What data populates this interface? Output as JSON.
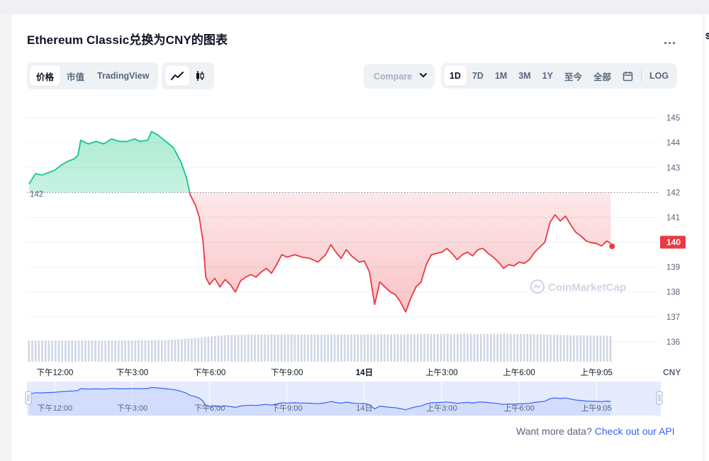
{
  "header": {
    "title": "Ethereum Classic兑换为CNY的图表",
    "more_label": "..."
  },
  "toolbar": {
    "metric_tabs": [
      {
        "label": "价格",
        "active": true
      },
      {
        "label": "市值",
        "active": false
      },
      {
        "label": "TradingView",
        "active": false
      }
    ],
    "chart_type": [
      "line-chart-icon",
      "candlestick-icon"
    ],
    "compare_label": "Compare",
    "ranges": [
      {
        "label": "1D",
        "active": true
      },
      {
        "label": "7D",
        "active": false
      },
      {
        "label": "1M",
        "active": false
      },
      {
        "label": "3M",
        "active": false
      },
      {
        "label": "1Y",
        "active": false
      },
      {
        "label": "至今",
        "active": false
      },
      {
        "label": "全部",
        "active": false
      }
    ],
    "calendar_icon": "calendar-icon",
    "log_label": "LOG"
  },
  "chart_data": {
    "type": "area",
    "currency_label": "CNY",
    "reference_label": "142",
    "reference_value": 142,
    "current_price_label": "140",
    "ylim": [
      135.2,
      145.6
    ],
    "yticks": [
      136,
      137,
      138,
      139,
      140,
      141,
      142,
      143,
      144,
      145
    ],
    "xlim": [
      0,
      24
    ],
    "xticks": [
      {
        "t": 1.0,
        "label": "下午12:00"
      },
      {
        "t": 4.0,
        "label": "下午3:00"
      },
      {
        "t": 7.0,
        "label": "下午6:00"
      },
      {
        "t": 10.0,
        "label": "下午9:00"
      },
      {
        "t": 13.0,
        "label": "14日"
      },
      {
        "t": 16.0,
        "label": "上午3:00"
      },
      {
        "t": 19.0,
        "label": "上午6:00"
      },
      {
        "t": 22.0,
        "label": "上午9:05"
      }
    ],
    "colors": {
      "up": "#16c784",
      "down": "#ea3943",
      "volume": "#cfd6e4",
      "navigator": "#3861fb",
      "navigator_fill": "#e5ebfd"
    },
    "price_series": [
      [
        0.0,
        142.35
      ],
      [
        0.25,
        142.75
      ],
      [
        0.5,
        142.7
      ],
      [
        0.75,
        142.8
      ],
      [
        1.0,
        142.9
      ],
      [
        1.25,
        143.1
      ],
      [
        1.5,
        143.25
      ],
      [
        1.75,
        143.35
      ],
      [
        1.9,
        143.5
      ],
      [
        2.0,
        144.1
      ],
      [
        2.3,
        143.95
      ],
      [
        2.6,
        144.05
      ],
      [
        2.9,
        143.95
      ],
      [
        3.2,
        144.15
      ],
      [
        3.5,
        144.05
      ],
      [
        3.8,
        144.05
      ],
      [
        4.1,
        144.15
      ],
      [
        4.3,
        144.05
      ],
      [
        4.6,
        144.1
      ],
      [
        4.75,
        144.45
      ],
      [
        5.0,
        144.3
      ],
      [
        5.3,
        144.05
      ],
      [
        5.6,
        143.8
      ],
      [
        5.9,
        143.2
      ],
      [
        6.1,
        142.6
      ],
      [
        6.25,
        141.9
      ],
      [
        6.45,
        141.5
      ],
      [
        6.6,
        141.0
      ],
      [
        6.75,
        140.0
      ],
      [
        6.85,
        138.6
      ],
      [
        7.0,
        138.3
      ],
      [
        7.2,
        138.55
      ],
      [
        7.4,
        138.2
      ],
      [
        7.6,
        138.5
      ],
      [
        7.8,
        138.3
      ],
      [
        8.0,
        138.0
      ],
      [
        8.2,
        138.45
      ],
      [
        8.4,
        138.6
      ],
      [
        8.6,
        138.7
      ],
      [
        8.8,
        138.6
      ],
      [
        9.0,
        138.8
      ],
      [
        9.2,
        138.95
      ],
      [
        9.4,
        138.75
      ],
      [
        9.6,
        139.1
      ],
      [
        9.8,
        139.5
      ],
      [
        10.0,
        139.4
      ],
      [
        10.3,
        139.5
      ],
      [
        10.6,
        139.4
      ],
      [
        10.9,
        139.35
      ],
      [
        11.2,
        139.2
      ],
      [
        11.5,
        139.5
      ],
      [
        11.7,
        139.9
      ],
      [
        11.9,
        139.6
      ],
      [
        12.1,
        139.35
      ],
      [
        12.3,
        139.7
      ],
      [
        12.5,
        139.45
      ],
      [
        12.8,
        139.2
      ],
      [
        13.0,
        139.25
      ],
      [
        13.2,
        138.8
      ],
      [
        13.4,
        137.5
      ],
      [
        13.6,
        138.4
      ],
      [
        13.8,
        138.2
      ],
      [
        14.0,
        138.0
      ],
      [
        14.2,
        137.9
      ],
      [
        14.4,
        137.6
      ],
      [
        14.6,
        137.2
      ],
      [
        14.8,
        137.75
      ],
      [
        15.0,
        138.2
      ],
      [
        15.2,
        138.4
      ],
      [
        15.4,
        139.1
      ],
      [
        15.6,
        139.5
      ],
      [
        15.8,
        139.55
      ],
      [
        16.0,
        139.6
      ],
      [
        16.2,
        139.75
      ],
      [
        16.4,
        139.55
      ],
      [
        16.6,
        139.3
      ],
      [
        16.8,
        139.5
      ],
      [
        17.0,
        139.6
      ],
      [
        17.2,
        139.45
      ],
      [
        17.4,
        139.7
      ],
      [
        17.6,
        139.75
      ],
      [
        17.8,
        139.55
      ],
      [
        18.0,
        139.4
      ],
      [
        18.2,
        139.2
      ],
      [
        18.4,
        138.95
      ],
      [
        18.6,
        139.1
      ],
      [
        18.8,
        139.05
      ],
      [
        19.0,
        139.2
      ],
      [
        19.2,
        139.15
      ],
      [
        19.4,
        139.3
      ],
      [
        19.6,
        139.6
      ],
      [
        19.8,
        139.8
      ],
      [
        20.0,
        140.0
      ],
      [
        20.2,
        140.8
      ],
      [
        20.4,
        141.1
      ],
      [
        20.6,
        140.85
      ],
      [
        20.8,
        141.05
      ],
      [
        21.0,
        140.7
      ],
      [
        21.2,
        140.4
      ],
      [
        21.4,
        140.25
      ],
      [
        21.6,
        140.05
      ],
      [
        21.8,
        139.98
      ],
      [
        22.0,
        139.95
      ],
      [
        22.2,
        139.85
      ],
      [
        22.4,
        140.05
      ],
      [
        22.55,
        139.95
      ]
    ],
    "volume_range": [
      0,
      1
    ],
    "volume_series": [
      [
        0.0,
        0.62
      ],
      [
        3.0,
        0.62
      ],
      [
        5.5,
        0.64
      ],
      [
        6.5,
        0.7
      ],
      [
        7.5,
        0.78
      ],
      [
        9.0,
        0.8
      ],
      [
        13.0,
        0.8
      ],
      [
        16.0,
        0.82
      ],
      [
        19.0,
        0.82
      ],
      [
        21.0,
        0.78
      ],
      [
        22.55,
        0.76
      ]
    ]
  },
  "footer": {
    "text": "Want more data?",
    "link": "Check out our API"
  },
  "watermark": {
    "text": "CoinMarketCap"
  }
}
